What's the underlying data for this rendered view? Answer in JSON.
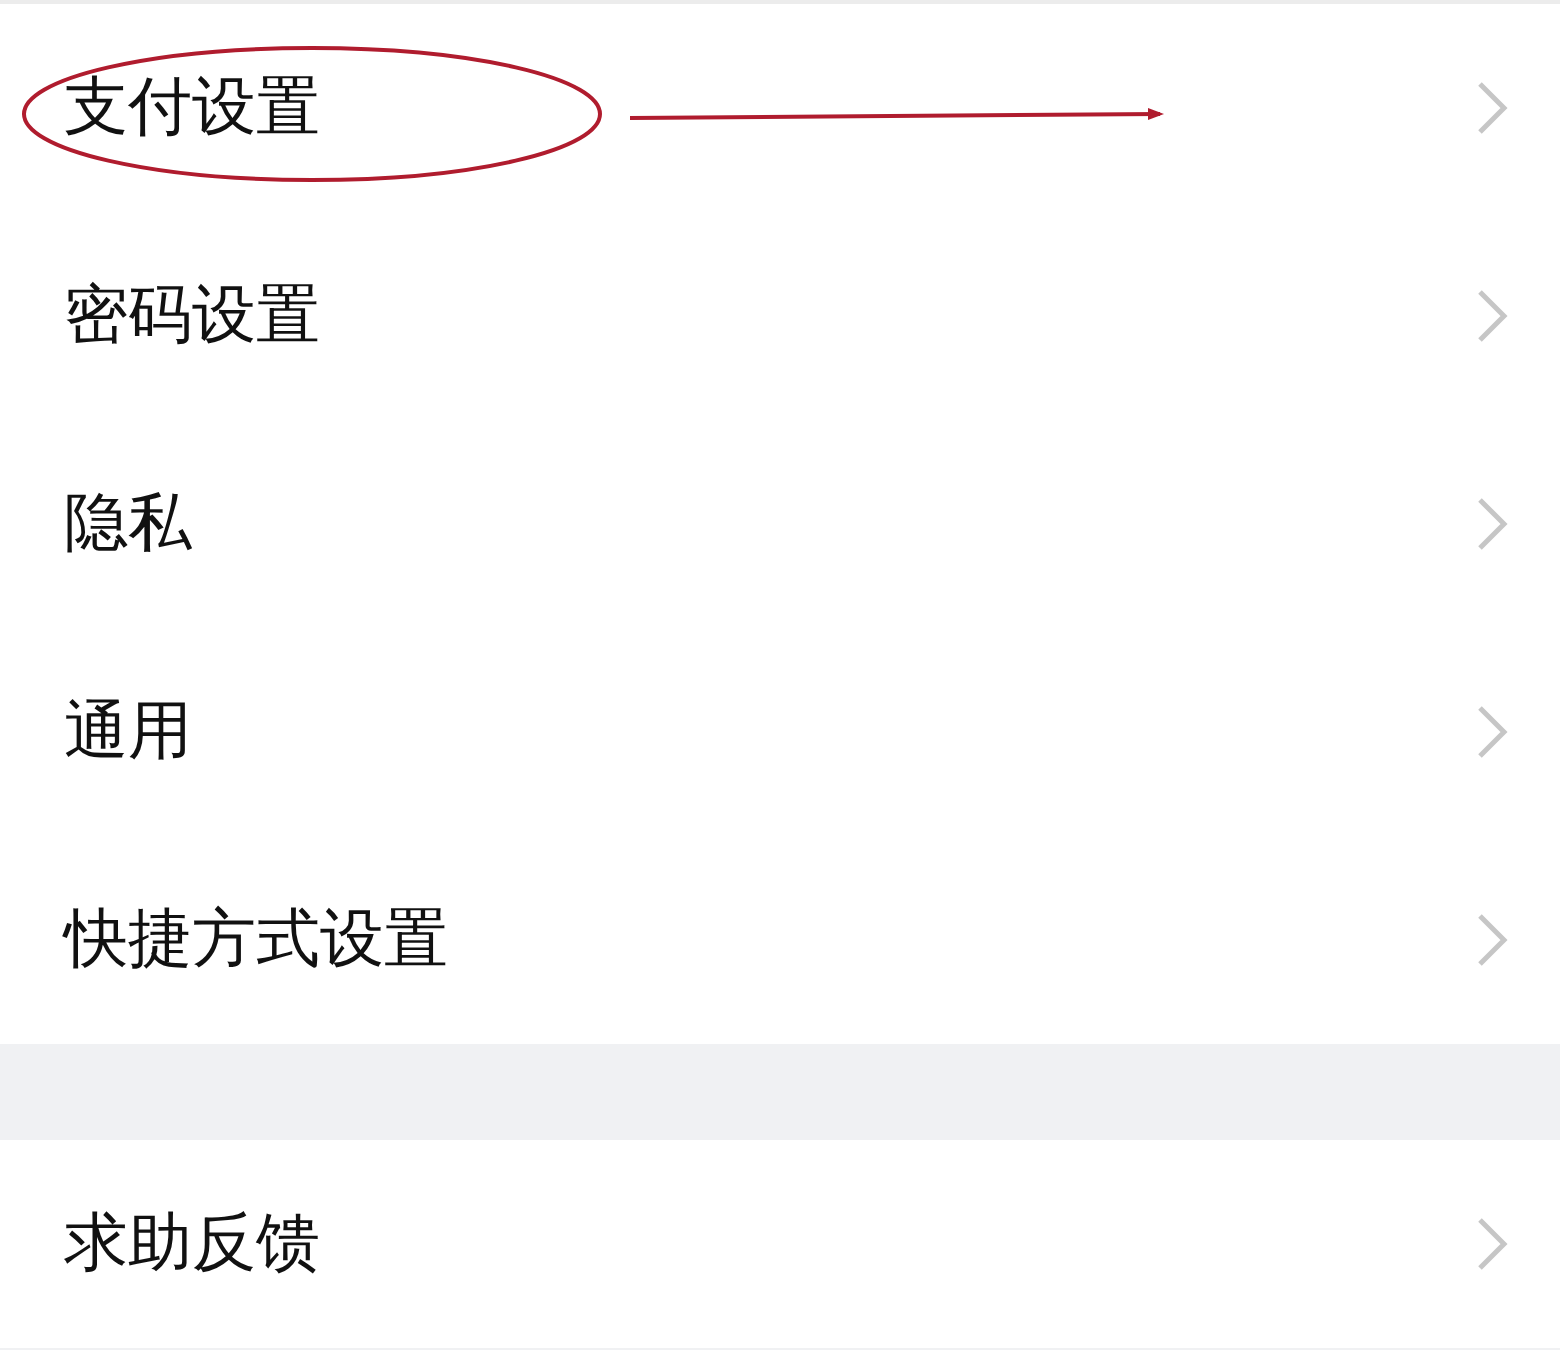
{
  "groups": [
    {
      "items": [
        {
          "label": "支付设置",
          "annotated": true
        },
        {
          "label": "密码设置",
          "annotated": false
        },
        {
          "label": "隐私",
          "annotated": false
        },
        {
          "label": "通用",
          "annotated": false
        },
        {
          "label": "快捷方式设置",
          "annotated": false
        }
      ]
    },
    {
      "items": [
        {
          "label": "求助反馈",
          "annotated": false
        }
      ]
    }
  ]
}
